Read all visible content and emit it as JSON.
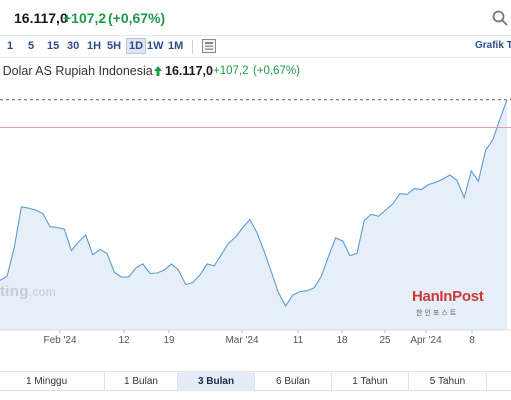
{
  "header": {
    "price": "16.117,0",
    "change": "+107,2",
    "change_pct": "(+0,67%)"
  },
  "toolbar": {
    "timeframes": [
      "1",
      "5",
      "15",
      "30",
      "1H",
      "5H",
      "1D",
      "1W",
      "1M"
    ],
    "active_timeframe": "1D",
    "chart_type_icon": "candlestick-chart-icon",
    "grafik_link": "Grafik Te"
  },
  "chart_title": {
    "name": "r Dolar AS Rupiah Indonesia",
    "price": "16.117,0",
    "change": "+107,2",
    "change_pct": "(+0,67%)",
    "arrow_icon": "up-arrow-icon"
  },
  "watermark": {
    "brand": "ting",
    "suffix": ".com"
  },
  "logo": {
    "main": "HanInPost",
    "sub": "한인포스트"
  },
  "range_buttons": [
    "1 Minggu",
    "1 Bulan",
    "3 Bulan",
    "6 Bulan",
    "1 Tahun",
    "5 Tahun"
  ],
  "active_range": "3 Bulan",
  "colors": {
    "up": "#1e9a4a",
    "line": "#5b9bd5",
    "area": "#e6eef8",
    "accent": "#2d4e8a"
  },
  "chart_data": {
    "type": "area",
    "x_ticks": [
      "Feb '24",
      "12",
      "19",
      "Mar '24",
      "11",
      "18",
      "25",
      "Apr '24",
      "8"
    ],
    "series": [
      {
        "values": [
          15680,
          15690,
          15760,
          15858,
          15855,
          15850,
          15842,
          15810,
          15808,
          15804,
          15752,
          15773,
          15790,
          15742,
          15755,
          15745,
          15700,
          15688,
          15688,
          15710,
          15720,
          15697,
          15698,
          15705,
          15720,
          15705,
          15670,
          15675,
          15693,
          15720,
          15715,
          15743,
          15770,
          15785,
          15808,
          15827,
          15795,
          15750,
          15700,
          15650,
          15618,
          15645,
          15653,
          15655,
          15662,
          15690,
          15738,
          15783,
          15775,
          15740,
          15745,
          15825,
          15840,
          15835,
          15850,
          15865,
          15890,
          15888,
          15902,
          15900,
          15912,
          15917,
          15925,
          15935,
          15922,
          15880,
          15945,
          15920,
          15995,
          16020,
          16070,
          16117
        ]
      }
    ],
    "reference_lines": {
      "dashed_current": 16117,
      "pink_level": 16050
    },
    "ylim": [
      15560,
      16160
    ],
    "grid": false
  }
}
